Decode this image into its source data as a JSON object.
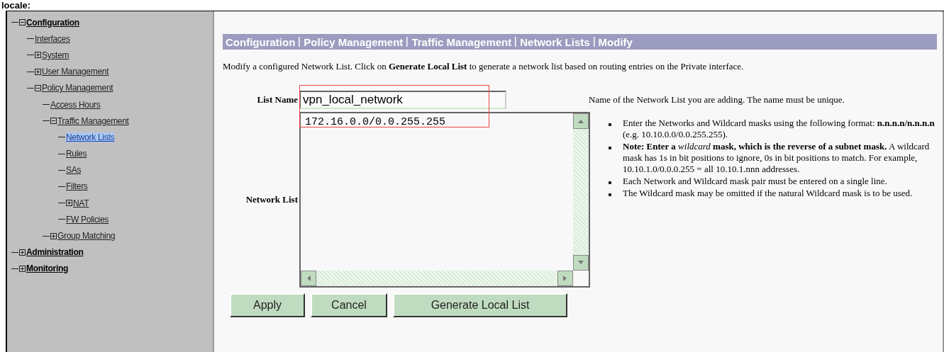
{
  "caption": "locale:",
  "tree": [
    {
      "label": "Configuration",
      "expanded": true,
      "selected": false,
      "children": [
        {
          "label": "Interfaces",
          "selected": false
        },
        {
          "label": "System",
          "expanded": false,
          "selected": false
        },
        {
          "label": "User Management",
          "expanded": false,
          "selected": false
        },
        {
          "label": "Policy Management",
          "expanded": true,
          "selected": false,
          "children": [
            {
              "label": "Access Hours",
              "selected": false
            },
            {
              "label": "Traffic Management",
              "expanded": true,
              "selected": false,
              "children": [
                {
                  "label": "Network Lists",
                  "selected": true
                },
                {
                  "label": "Rules",
                  "selected": false
                },
                {
                  "label": "SAs",
                  "selected": false
                },
                {
                  "label": "Filters",
                  "selected": false
                },
                {
                  "label": "NAT",
                  "expanded": false,
                  "selected": false
                },
                {
                  "label": "FW Policies",
                  "selected": false
                }
              ]
            },
            {
              "label": "Group Matching",
              "expanded": false,
              "selected": false
            }
          ]
        }
      ]
    },
    {
      "label": "Administration",
      "expanded": false,
      "selected": false
    },
    {
      "label": "Monitoring",
      "expanded": false,
      "selected": false
    }
  ],
  "breadcrumb": [
    "Configuration",
    "Policy Management",
    "Traffic Management",
    "Network Lists",
    "Modify"
  ],
  "intro": "Modify a configured Network List. Click on **Generate Local List** to generate a network list based on routing entries on the Private interface.",
  "form": {
    "name_label": "List Name",
    "name_value": "vpn_local_network",
    "name_help": "Name of the Network List you are adding. The name must be unique.",
    "list_label": "Network List",
    "list_value": "172.16.0.0/0.0.255.255",
    "help_items": [
      "Enter the Networks and Wildcard masks using the following format: **n.n.n.n/n.n.n.n** (e.g. 10.10.0.0/0.0.255.255).",
      "**Note: Enter a** *wildcard* **mask, which is the reverse of a subnet mask.** A wildcard mask has 1s in bit positions to ignore, 0s in bit positions to match. For example, 10.10.1.0/0.0.0.255 = all 10.10.1.nnn addresses.",
      "Each Network and Wildcard mask pair must be entered on a single line.",
      "The Wildcard mask may be omitted if the natural Wildcard mask is to be used."
    ]
  },
  "buttons": [
    "Apply",
    "Cancel",
    "Generate Local List"
  ]
}
